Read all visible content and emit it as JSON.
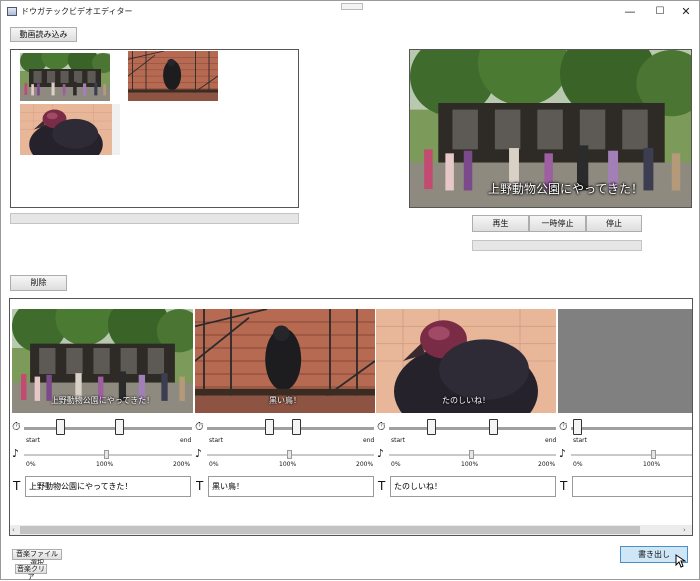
{
  "window": {
    "title": "ドウガテックビデオエディター",
    "minimize_glyph": "—",
    "maximize_glyph": "☐",
    "close_glyph": "✕"
  },
  "toolbar": {
    "load_video_label": "動画読み込み",
    "delete_label": "削除"
  },
  "preview": {
    "caption": "上野動物公園にやってきた！"
  },
  "playback": {
    "play_label": "再生",
    "pause_label": "一時停止",
    "stop_label": "停止"
  },
  "clips": [
    {
      "caption": "上野動物公園にやってきた！",
      "text_value": "上野動物公園にやってきた！"
    },
    {
      "caption": "黒い鳥！",
      "text_value": "黒い鳥！"
    },
    {
      "caption": "たのしいね！",
      "text_value": "たのしいね！"
    },
    {
      "caption": "",
      "text_value": ""
    }
  ],
  "trim": {
    "start_label": "start",
    "end_label": "end"
  },
  "volume": {
    "min_label": "0%",
    "mid_label": "100%",
    "max_label": "200%"
  },
  "icons": {
    "timer_glyph": "⏱",
    "music_glyph": "♪",
    "text_glyph": "T"
  },
  "footer": {
    "select_music_label": "音楽ファイル選択",
    "clear_music_label": "音楽クリア",
    "export_label": "書き出し"
  },
  "colors": {
    "export_button": "#cfe6f7",
    "empty_clip": "#808080"
  }
}
